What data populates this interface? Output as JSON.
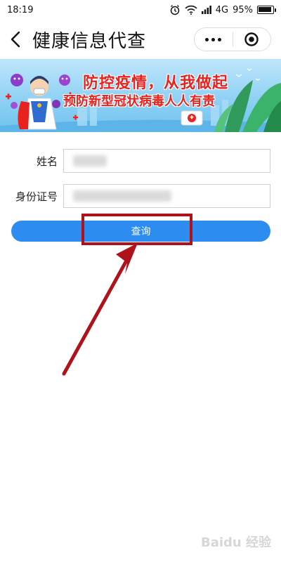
{
  "status_bar": {
    "time": "18:19",
    "network": "4G",
    "battery": "95%",
    "battery_level": 0.95
  },
  "nav": {
    "title": "健康信息代查",
    "back_icon": "chevron-left-icon",
    "more_icon": "more-dots-icon",
    "close_icon": "target-circle-icon"
  },
  "banner": {
    "line1": "防控疫情，从我做起",
    "line2": "预防新型冠状病毒人人有责"
  },
  "form": {
    "name_label": "姓名",
    "name_value": "",
    "id_label": "身份证号",
    "id_value": ""
  },
  "query_button": {
    "label": "查询",
    "color": "#2d8cf0"
  },
  "annotation": {
    "color": "#b0121b"
  },
  "watermark": "Baidu 经验"
}
